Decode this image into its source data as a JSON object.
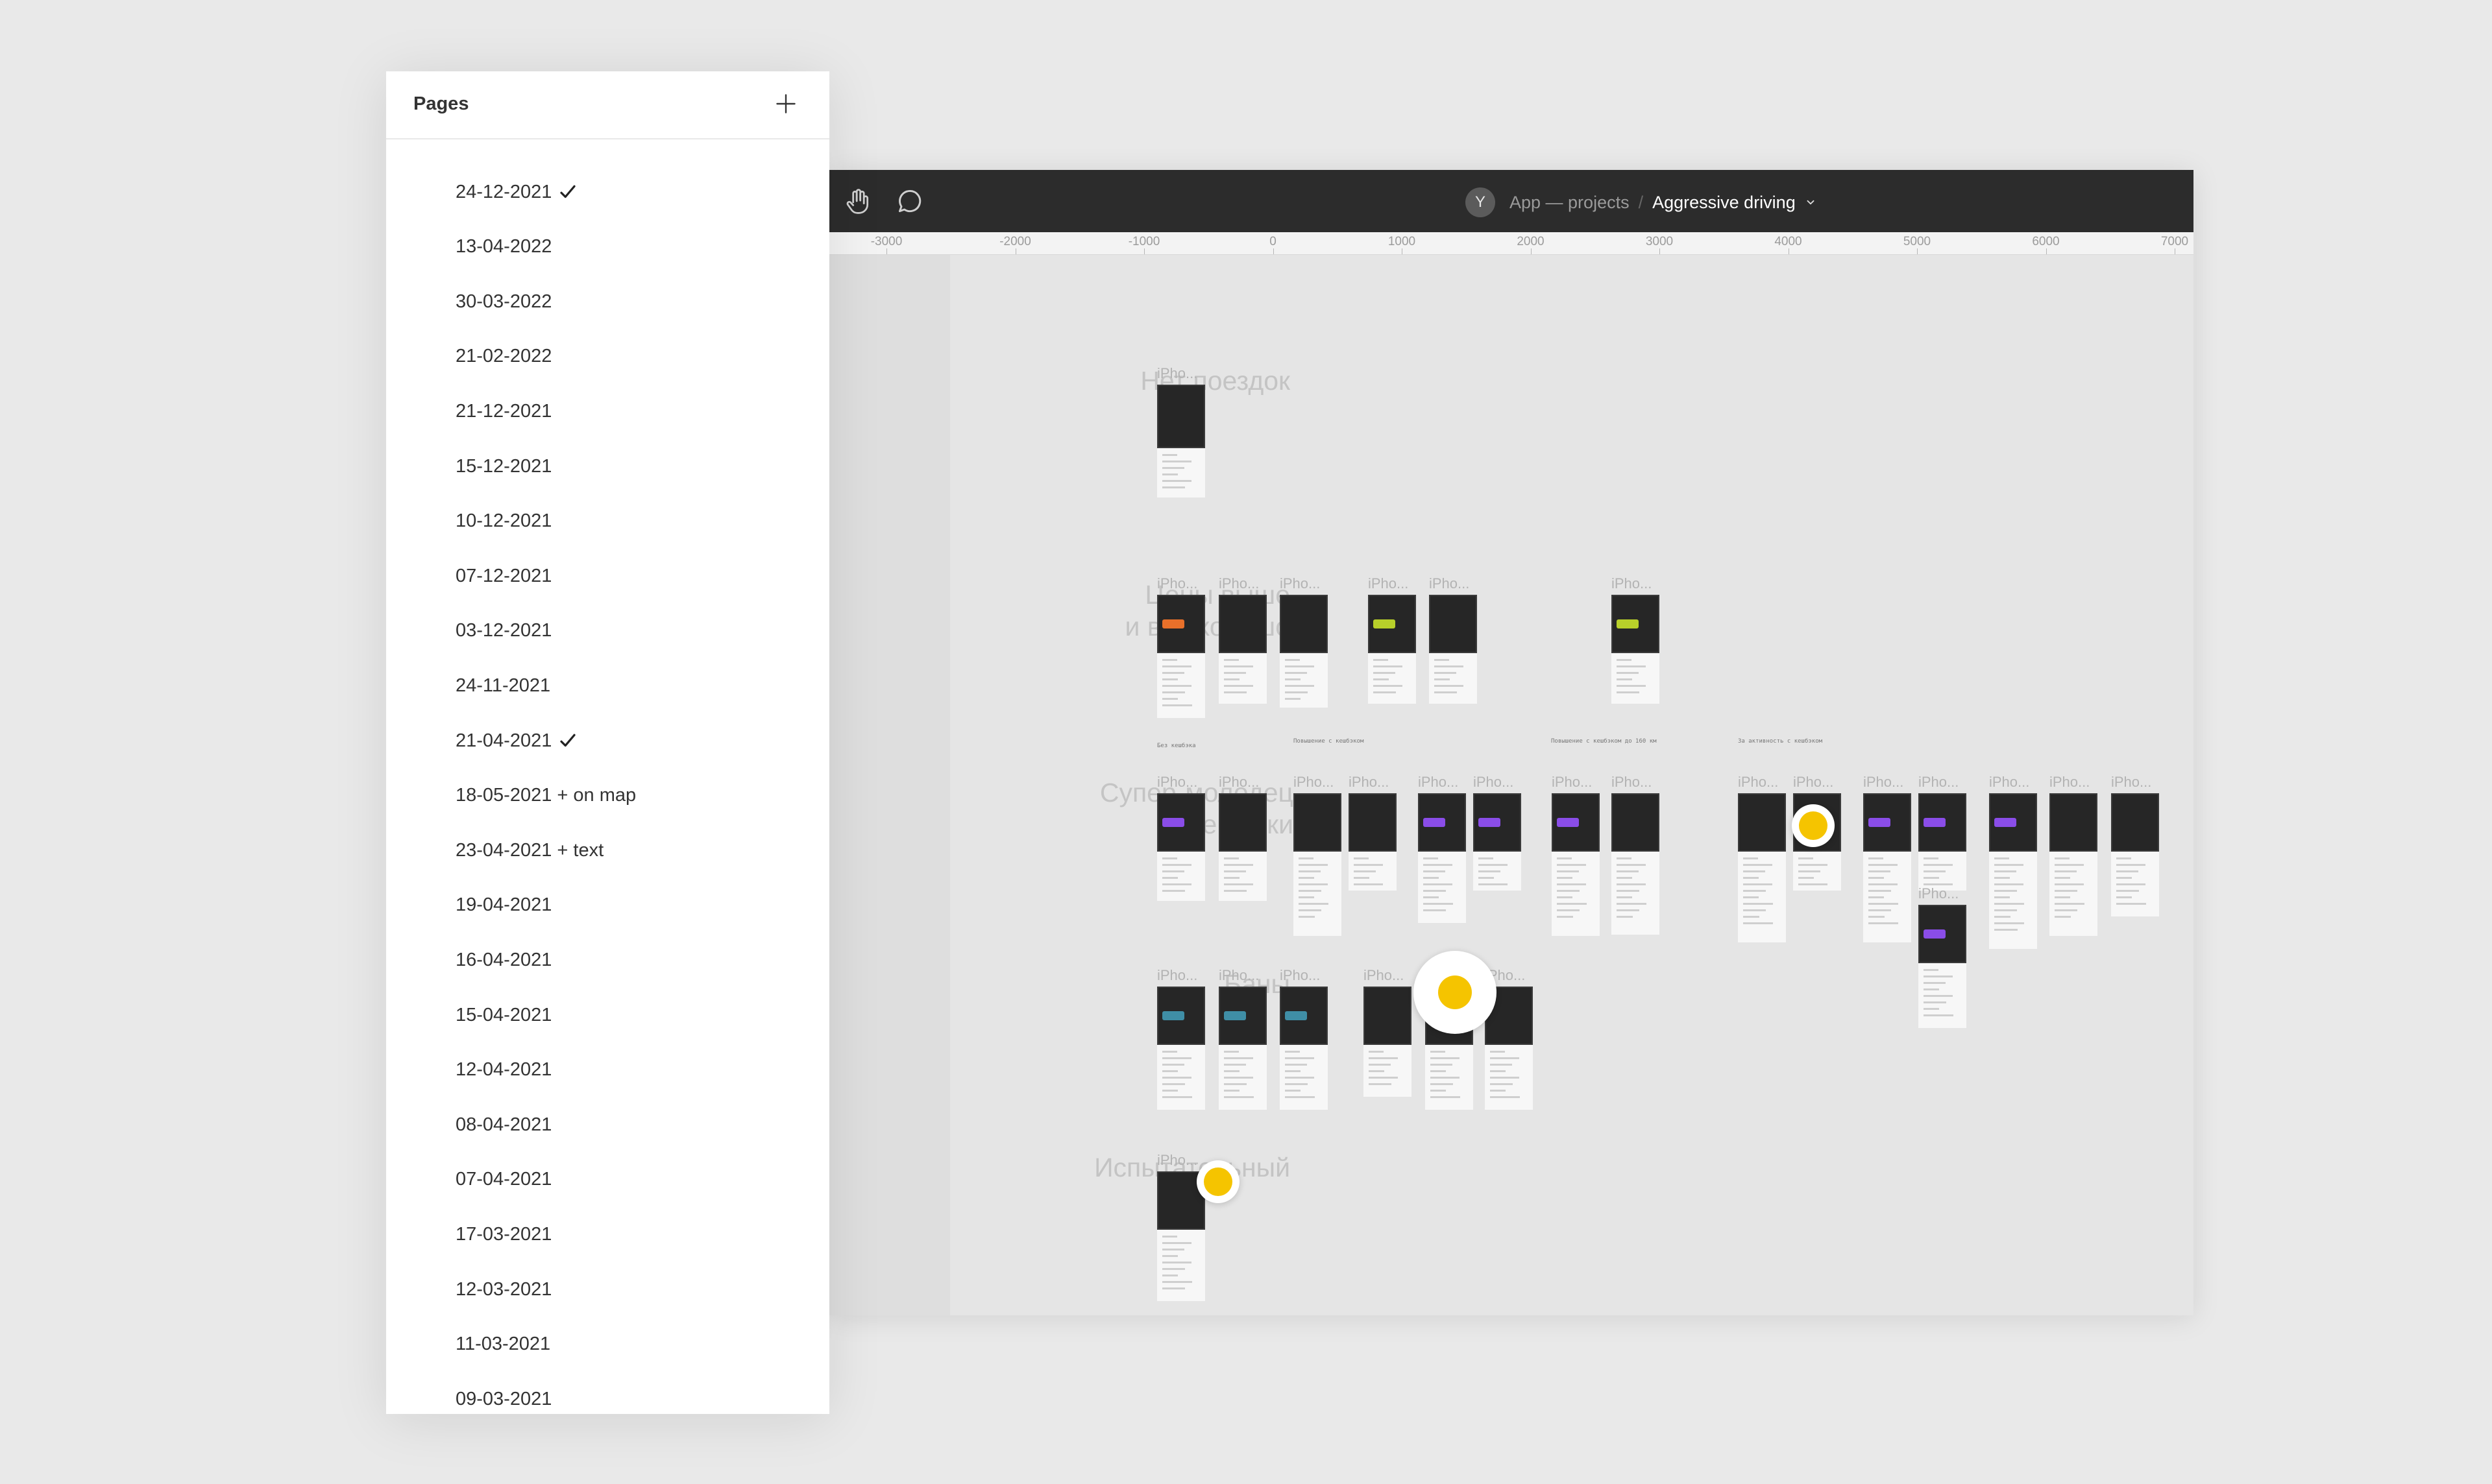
{
  "pages_panel": {
    "title": "Pages",
    "add_icon": "plus-icon",
    "pages": [
      {
        "label": "24-12-2021",
        "checked": true
      },
      {
        "label": "13-04-2022",
        "checked": false
      },
      {
        "label": "30-03-2022",
        "checked": false
      },
      {
        "label": "21-02-2022",
        "checked": false
      },
      {
        "label": "21-12-2021",
        "checked": false
      },
      {
        "label": "15-12-2021",
        "checked": false
      },
      {
        "label": "10-12-2021",
        "checked": false
      },
      {
        "label": "07-12-2021",
        "checked": false
      },
      {
        "label": "03-12-2021",
        "checked": false
      },
      {
        "label": "24-11-2021",
        "checked": false
      },
      {
        "label": "21-04-2021",
        "checked": true
      },
      {
        "label": "18-05-2021 + on map",
        "checked": false
      },
      {
        "label": "23-04-2021 + text",
        "checked": false
      },
      {
        "label": "19-04-2021",
        "checked": false
      },
      {
        "label": "16-04-2021",
        "checked": false
      },
      {
        "label": "15-04-2021",
        "checked": false
      },
      {
        "label": "12-04-2021",
        "checked": false
      },
      {
        "label": "08-04-2021",
        "checked": false
      },
      {
        "label": "07-04-2021",
        "checked": false
      },
      {
        "label": "17-03-2021",
        "checked": false
      },
      {
        "label": "12-03-2021",
        "checked": false
      },
      {
        "label": "11-03-2021",
        "checked": false
      },
      {
        "label": "09-03-2021",
        "checked": false
      }
    ]
  },
  "toolbar": {
    "tools": [
      "hand-icon",
      "comment-icon"
    ],
    "avatar_initial": "Y",
    "project": "App — projects",
    "separator": "/",
    "file_name": "Aggressive driving",
    "file_menu_icon": "chevron-down-icon"
  },
  "ruler": {
    "labels": [
      "-3000",
      "-2000",
      "-1000",
      "0",
      "1000",
      "2000",
      "3000",
      "4000",
      "5000",
      "6000",
      "7000"
    ]
  },
  "canvas": {
    "sections": [
      {
        "title_lines": [
          "Нет поездок"
        ]
      },
      {
        "title_lines": [
          "Цены выше",
          "и всё хорошо"
        ]
      },
      {
        "title_lines": [
          "Супер-молодец",
          "и кешбэки"
        ]
      },
      {
        "title_lines": [
          "Баны"
        ]
      },
      {
        "title_lines": [
          "Испытательный"
        ]
      }
    ],
    "frame_label": "iPho...",
    "notes": [
      "Без кешбэка",
      "Повышение с кешбэком",
      "Повышение с кешбэком до 160 км",
      "За активность с кешбэком"
    ],
    "accent_colors": {
      "orange": "#e8702a",
      "green": "#b8d02a",
      "purple": "#8a4de8",
      "teal": "#3f8ea6",
      "coin": "#f5c400"
    }
  }
}
